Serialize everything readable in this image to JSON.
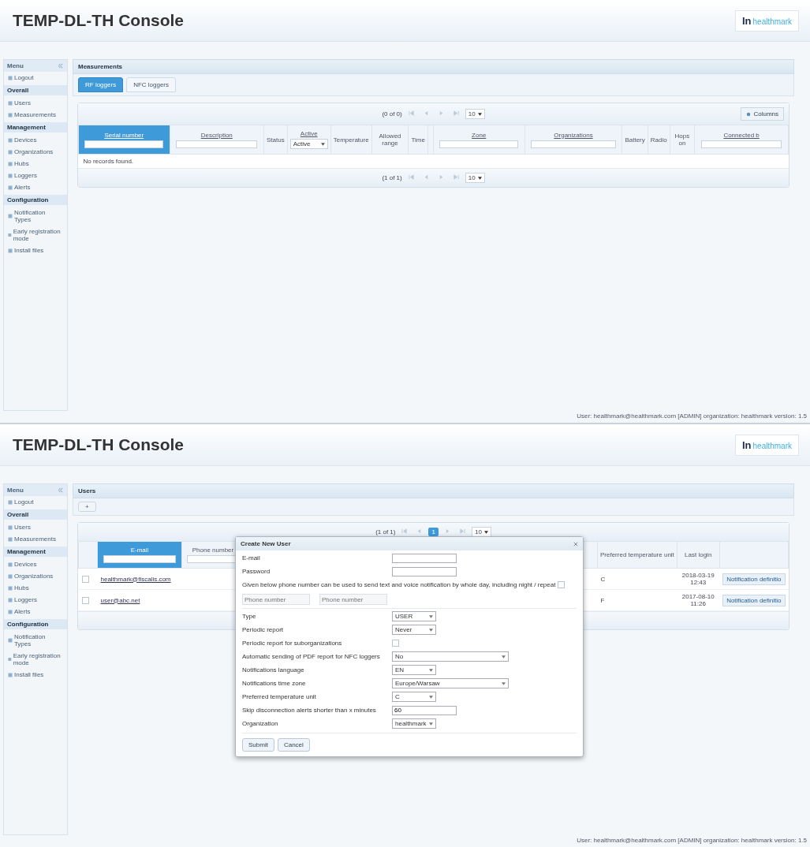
{
  "measurements_screen": {
    "header": {
      "title": "TEMP-DL-TH Console",
      "logo_mark": "In",
      "logo_text": "healthmark"
    },
    "sidebar": {
      "title": "Menu",
      "items": [
        {
          "kind": "link",
          "label": "Logout"
        },
        {
          "kind": "section",
          "label": "Overall"
        },
        {
          "kind": "link",
          "label": "Users"
        },
        {
          "kind": "link",
          "label": "Measurements"
        },
        {
          "kind": "section",
          "label": "Management"
        },
        {
          "kind": "link",
          "label": "Devices"
        },
        {
          "kind": "link",
          "label": "Organizations"
        },
        {
          "kind": "link",
          "label": "Hubs"
        },
        {
          "kind": "link",
          "label": "Loggers"
        },
        {
          "kind": "link",
          "label": "Alerts"
        },
        {
          "kind": "section",
          "label": "Configuration"
        },
        {
          "kind": "link",
          "label": "Notification Types"
        },
        {
          "kind": "link",
          "label": "Early registration mode"
        },
        {
          "kind": "link",
          "label": "Install files"
        }
      ]
    },
    "panel_title": "Measurements",
    "tabs": [
      {
        "label": "RF loggers",
        "selected": true
      },
      {
        "label": "NFC loggers",
        "selected": false
      }
    ],
    "top_paginator": {
      "count": "(0 of 0)",
      "page_size": "10"
    },
    "columns_button": "Columns",
    "columns": [
      {
        "label": "Serial number",
        "selected": true,
        "filter": {
          "kind": "text"
        }
      },
      {
        "label": "Description",
        "selected": false,
        "filter": {
          "kind": "text"
        }
      },
      {
        "label": "Status",
        "selected": false
      },
      {
        "label": "Active",
        "selected": false,
        "filter": {
          "kind": "select",
          "value": "Active"
        }
      },
      {
        "label": "Temperature",
        "selected": false
      },
      {
        "label": "Allowed range",
        "selected": false
      },
      {
        "label": "Time",
        "selected": false
      },
      {
        "selected": false
      },
      {
        "label": "Zone",
        "selected": false,
        "filter": {
          "kind": "text"
        }
      },
      {
        "label": "Organizations",
        "selected": false,
        "filter": {
          "kind": "text"
        }
      },
      {
        "label": "Battery",
        "selected": false
      },
      {
        "label": "Radio",
        "selected": false
      },
      {
        "label": "Hops on",
        "selected": false
      },
      {
        "label": "Connected b",
        "selected": false,
        "filter": {
          "kind": "text"
        }
      }
    ],
    "empty_message": "No records found.",
    "bottom_paginator": {
      "count": "(1 of 1)",
      "page_size": "10"
    },
    "footer": "User: healthmark@healthmark.com [ADMIN] organization: healthmark version: 1.5"
  },
  "users_screen": {
    "header": {
      "title": "TEMP-DL-TH Console",
      "logo_mark": "In",
      "logo_text": "healthmark"
    },
    "sidebar": {
      "title": "Menu",
      "items": [
        {
          "kind": "link",
          "label": "Logout"
        },
        {
          "kind": "section",
          "label": "Overall"
        },
        {
          "kind": "link",
          "label": "Users"
        },
        {
          "kind": "link",
          "label": "Measurements"
        },
        {
          "kind": "section",
          "label": "Management"
        },
        {
          "kind": "link",
          "label": "Devices"
        },
        {
          "kind": "link",
          "label": "Organizations"
        },
        {
          "kind": "link",
          "label": "Hubs"
        },
        {
          "kind": "link",
          "label": "Loggers"
        },
        {
          "kind": "link",
          "label": "Alerts"
        },
        {
          "kind": "section",
          "label": "Configuration"
        },
        {
          "kind": "link",
          "label": "Notification Types"
        },
        {
          "kind": "link",
          "label": "Early registration mode"
        },
        {
          "kind": "link",
          "label": "Install files"
        }
      ]
    },
    "panel_title": "Users",
    "add_button": "+",
    "paginator": {
      "count": "(1 of 1)",
      "pages": [
        {
          "label": "1",
          "selected": true
        }
      ],
      "page_size": "10"
    },
    "columns": [
      {
        "label": "E-mail",
        "selected": true,
        "filter": true
      },
      {
        "label": "Phone number",
        "selected": false,
        "filter": true
      },
      {
        "label": "Preferred temperature unit",
        "selected": false,
        "filter": false
      },
      {
        "label": "Last login",
        "selected": false,
        "filter": false
      }
    ],
    "rows": [
      {
        "checked": false,
        "email": "healthmark@fiscalis.com",
        "unit": "C",
        "last_login": "2018-03-19 12:43",
        "action": "Notification definitio"
      },
      {
        "checked": false,
        "email": "user@abc.net",
        "unit": "F",
        "last_login": "2017-08-10 11:26",
        "action": "Notification definitio"
      }
    ],
    "dialog": {
      "title": "Create New User",
      "fields": [
        {
          "kind": "input",
          "label": "E-mail"
        },
        {
          "kind": "input",
          "label": "Password"
        },
        {
          "kind": "checkbox",
          "label": "Given below phone number can be used to send text and voice notification by whole day, including night / repeat",
          "checked": false
        },
        {
          "kind": "pair",
          "placeholders": [
            "Phone number",
            "Phone number"
          ]
        },
        {
          "kind": "select",
          "label": "Type",
          "value": "USER"
        },
        {
          "kind": "select",
          "label": "Periodic report",
          "value": "Never"
        },
        {
          "kind": "checkbox",
          "label": "Periodic report for suborganizations",
          "checked": false
        },
        {
          "kind": "wideselect",
          "label": "Automatic sending of PDF report for NFC loggers",
          "value": "No"
        },
        {
          "kind": "select",
          "label": "Notifications language",
          "value": "EN"
        },
        {
          "kind": "wideselect",
          "label": "Notifications time zone",
          "value": "Europe/Warsaw"
        },
        {
          "kind": "select",
          "label": "Preferred temperature unit",
          "value": "C"
        },
        {
          "kind": "input",
          "label": "Skip disconnection alerts shorter than x minutes",
          "value": "60"
        },
        {
          "kind": "select",
          "label": "Organization",
          "value": "healthmark"
        }
      ],
      "buttons": [
        "Submit",
        "Cancel"
      ]
    },
    "footer": "User: healthmark@healthmark.com [ADMIN] organization: healthmark version: 1.5"
  }
}
